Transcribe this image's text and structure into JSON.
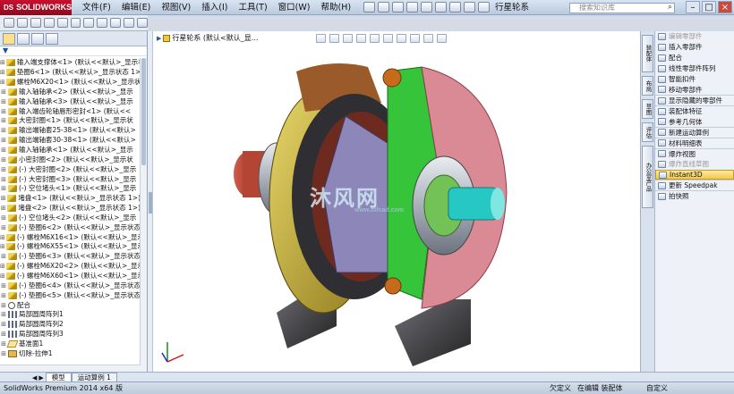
{
  "app": {
    "logo_text": "SOLIDWORKS",
    "logo_mark": "DS",
    "menus": [
      "文件(F)",
      "编辑(E)",
      "视图(V)",
      "插入(I)",
      "工具(T)",
      "窗口(W)",
      "帮助(H)"
    ],
    "document_title": "行星轮系",
    "search_placeholder": "搜索知识库",
    "window_buttons": [
      "–",
      "□",
      "×"
    ]
  },
  "feature_tree": {
    "root_label": "行星轮系 (默认<默认_显...",
    "items": [
      {
        "label": "输入端支撑体<1> (默认<<默认>_显示状",
        "icon": "part-icon"
      },
      {
        "label": "垫圈6<1> (默认<<默认>_显示状态 1>)",
        "icon": "part-icon"
      },
      {
        "label": "螺栓M6X20<1> (默认<<默认>_显示状",
        "icon": "part-icon"
      },
      {
        "label": "输入轴轴承<2> (默认<<默认>_显示",
        "icon": "part-icon"
      },
      {
        "label": "输入轴轴承<3> (默认<<默认>_显示",
        "icon": "part-icon"
      },
      {
        "label": "输入端齿轮轴唇形密封<1> (默认<<",
        "icon": "part-icon"
      },
      {
        "label": "大密封圈<1> (默认<<默认>_显示状",
        "icon": "part-icon"
      },
      {
        "label": "输出端轴套25-38<1> (默认<<默认>",
        "icon": "part-icon"
      },
      {
        "label": "输出端轴套30-38<1> (默认<<默认>",
        "icon": "part-icon"
      },
      {
        "label": "输入轴轴承<1> (默认<<默认>_显示",
        "icon": "part-icon"
      },
      {
        "label": "小密封圈<2> (默认<<默认>_显示状",
        "icon": "part-icon"
      },
      {
        "label": "(-) 大密封圈<2> (默认<<默认>_显示",
        "icon": "part-icon"
      },
      {
        "label": "(-) 大密封圈<3> (默认<<默认>_显示",
        "icon": "part-icon"
      },
      {
        "label": "(-) 空位堵头<1> (默认<<默认>_显示",
        "icon": "part-icon"
      },
      {
        "label": "堵盘<1> (默认<<默认>_显示状态 1>)",
        "icon": "part-icon"
      },
      {
        "label": "堵盘<2> (默认<<默认>_显示状态 1>)",
        "icon": "part-icon"
      },
      {
        "label": "(-) 空位堵头<2> (默认<<默认>_显示",
        "icon": "part-icon"
      },
      {
        "label": "(-) 垫圈6<2> (默认<<默认>_显示状态",
        "icon": "part-icon"
      },
      {
        "label": "(-) 螺栓M6X16<1> (默认<<默认>_显示",
        "icon": "part-icon"
      },
      {
        "label": "(-) 螺栓M6X55<1> (默认<<默认>_显示",
        "icon": "part-icon"
      },
      {
        "label": "(-) 垫圈6<3> (默认<<默认>_显示状态",
        "icon": "part-icon"
      },
      {
        "label": "(-) 螺栓M6X20<2> (默认<<默认>_显示",
        "icon": "part-icon"
      },
      {
        "label": "(-) 螺栓M6X60<1> (默认<<默认>_显示",
        "icon": "part-icon"
      },
      {
        "label": "(-) 垫圈6<4> (默认<<默认>_显示状态",
        "icon": "part-icon"
      },
      {
        "label": "(-) 垫圈6<5> (默认<<默认>_显示状态",
        "icon": "part-icon"
      },
      {
        "label": "配合",
        "icon": "mate-icon"
      },
      {
        "label": "局部圆周阵列1",
        "icon": "pattern-icon"
      },
      {
        "label": "局部圆周阵列2",
        "icon": "pattern-icon"
      },
      {
        "label": "局部圆周阵列3",
        "icon": "pattern-icon"
      },
      {
        "label": "基准面1",
        "icon": "plane-icon"
      },
      {
        "label": "切除-拉伸1",
        "icon": "cut-icon"
      }
    ]
  },
  "viewport": {
    "watermark_text": "沐风网",
    "watermark_sub": "www.mfcad.com"
  },
  "right_tabs": [
    "装配体",
    "布局",
    "草图",
    "评估",
    "办公室产品"
  ],
  "command_panel": {
    "items": [
      {
        "label": "编辑零部件",
        "state": "disabled"
      },
      {
        "label": "插入零部件",
        "state": "normal"
      },
      {
        "label": "配合",
        "state": "normal"
      },
      {
        "label": "线性零部件阵列",
        "state": "normal"
      },
      {
        "label": "智能扣件",
        "state": "normal"
      },
      {
        "label": "移动零部件",
        "state": "normal"
      },
      {
        "label": "显示隐藏的零部件",
        "state": "sep"
      },
      {
        "label": "装配体特征",
        "state": "sep"
      },
      {
        "label": "参考几何体",
        "state": "normal"
      },
      {
        "label": "新建运动算例",
        "state": "sep"
      },
      {
        "label": "材料明细表",
        "state": "sep"
      },
      {
        "label": "爆炸视图",
        "state": "sep"
      },
      {
        "label": "爆炸直线草图",
        "state": "disabled"
      },
      {
        "label": "Instant3D",
        "state": "active"
      },
      {
        "label": "更新 Speedpak",
        "state": "sep"
      },
      {
        "label": "拍快照",
        "state": "sep"
      }
    ]
  },
  "bottom_tabs": [
    "模型",
    "运动算例 1"
  ],
  "status": {
    "app_version": "SolidWorks Premium 2014 x64 版",
    "definition": "欠定义",
    "editing": "在编辑 装配体",
    "custom": "自定义"
  },
  "colors": {
    "titlebar_accent": "#c8102e",
    "viewport_bg": "#ffffff",
    "active_command": "#f5c94c"
  }
}
